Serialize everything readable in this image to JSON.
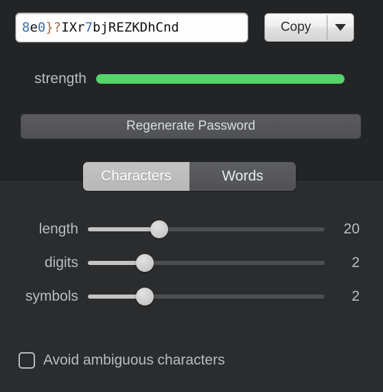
{
  "window": {
    "background_top": "#232426",
    "background_bottom": "#2b2c2e"
  },
  "password": {
    "value": "8e0}?IXr7bjREZKDhCnd",
    "segments": [
      {
        "text": "8",
        "kind": "digit"
      },
      {
        "text": "e",
        "kind": "alpha"
      },
      {
        "text": "0",
        "kind": "digit"
      },
      {
        "text": "}?",
        "kind": "symbol"
      },
      {
        "text": "IXr",
        "kind": "alpha"
      },
      {
        "text": "7",
        "kind": "digit"
      },
      {
        "text": "bjREZKDhCnd",
        "kind": "alpha"
      }
    ],
    "digit_color": "#3b6ea8",
    "symbol_color": "#9a6a44",
    "alpha_color": "#111111"
  },
  "copy": {
    "label": "Copy",
    "dropdown_icon": "chevron-down-icon"
  },
  "strength": {
    "label": "strength",
    "percent": 100,
    "color": "#55d46a"
  },
  "regenerate": {
    "label": "Regenerate Password"
  },
  "tabs": [
    {
      "label": "Characters",
      "selected": true
    },
    {
      "label": "Words",
      "selected": false
    }
  ],
  "sliders": [
    {
      "label": "length",
      "value": "20",
      "percent": 30
    },
    {
      "label": "digits",
      "value": "2",
      "percent": 24
    },
    {
      "label": "symbols",
      "value": "2",
      "percent": 24
    }
  ],
  "avoid_ambiguous": {
    "label": "Avoid ambiguous characters",
    "checked": false
  }
}
